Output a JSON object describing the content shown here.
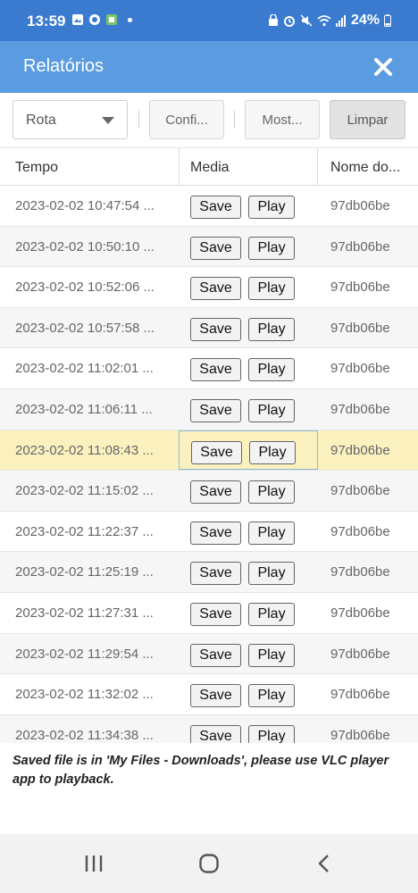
{
  "status_bar": {
    "time": "13:59",
    "battery": "24%",
    "icons_left": [
      "gallery-icon",
      "sync-icon",
      "app-notification-icon",
      "dot"
    ],
    "icons_right": [
      "vpn-icon",
      "alarm-icon",
      "mute-icon",
      "wifi-icon",
      "signal-icon",
      "battery-icon"
    ]
  },
  "header": {
    "title": "Relatórios",
    "close_icon": "close-icon"
  },
  "toolbar": {
    "select_label": "Rota",
    "config_label": "Confi...",
    "show_label": "Most...",
    "clear_label": "Limpar"
  },
  "table": {
    "columns": [
      "Tempo",
      "Media",
      "Nome do..."
    ],
    "save_label": "Save",
    "play_label": "Play",
    "rows": [
      {
        "time": "2023-02-02 10:47:54 ...",
        "name": "97db06be"
      },
      {
        "time": "2023-02-02 10:50:10 ...",
        "name": "97db06be"
      },
      {
        "time": "2023-02-02 10:52:06 ...",
        "name": "97db06be"
      },
      {
        "time": "2023-02-02 10:57:58 ...",
        "name": "97db06be"
      },
      {
        "time": "2023-02-02 11:02:01 ...",
        "name": "97db06be"
      },
      {
        "time": "2023-02-02 11:06:11 ...",
        "name": "97db06be"
      },
      {
        "time": "2023-02-02 11:08:43 ...",
        "name": "97db06be",
        "highlighted": true
      },
      {
        "time": "2023-02-02 11:15:02 ...",
        "name": "97db06be"
      },
      {
        "time": "2023-02-02 11:22:37 ...",
        "name": "97db06be"
      },
      {
        "time": "2023-02-02 11:25:19 ...",
        "name": "97db06be"
      },
      {
        "time": "2023-02-02 11:27:31 ...",
        "name": "97db06be"
      },
      {
        "time": "2023-02-02 11:29:54 ...",
        "name": "97db06be"
      },
      {
        "time": "2023-02-02 11:32:02 ...",
        "name": "97db06be"
      },
      {
        "time": "2023-02-02 11:34:38 ...",
        "name": "97db06be"
      }
    ]
  },
  "note": "Saved file is in 'My Files - Downloads', please use VLC player app to playback.",
  "nav_bar": {
    "icons": [
      "recents-icon",
      "home-icon",
      "back-icon"
    ]
  },
  "colors": {
    "status_bar": "#3a7bd0",
    "header": "#5b9be0",
    "highlight_row": "#fbf1bf"
  }
}
